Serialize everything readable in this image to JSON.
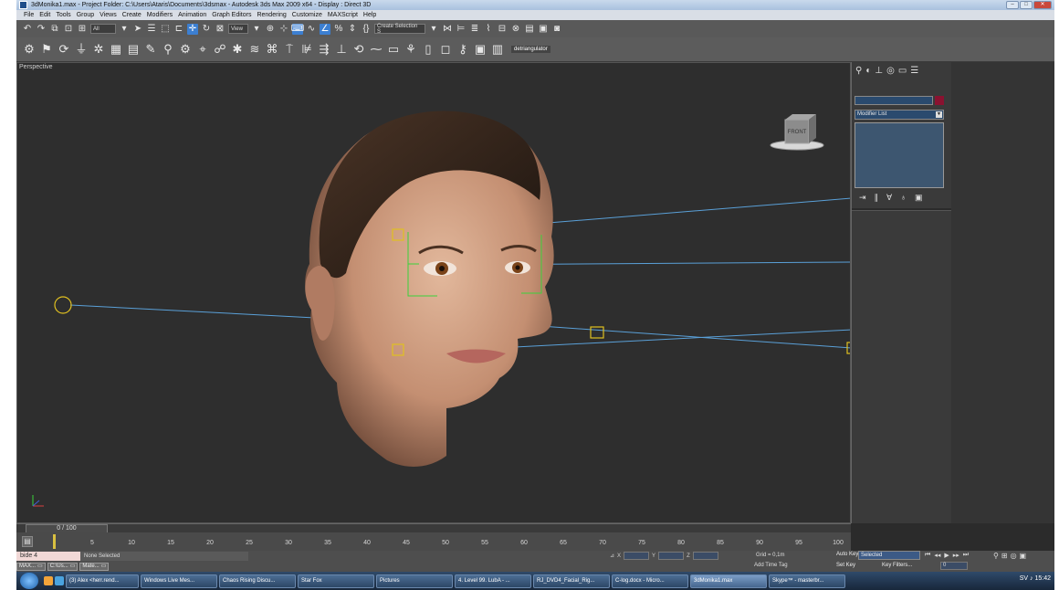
{
  "window": {
    "title": "3dMonika1.max    - Project Folder: C:\\Users\\Ataris\\Documents\\3dsmax    - Autodesk 3ds Max  2009 x64    - Display : Direct 3D",
    "controls": [
      "minimize",
      "maximize",
      "close"
    ]
  },
  "menu": [
    "File",
    "Edit",
    "Tools",
    "Group",
    "Views",
    "Create",
    "Modifiers",
    "Animation",
    "Graph Editors",
    "Rendering",
    "Customize",
    "MAXScript",
    "Help"
  ],
  "toolbar": {
    "selection_filter": "All",
    "ref_coord": "View",
    "named_selection": "Create Selection S",
    "extra_label": "detriangulator"
  },
  "viewport": {
    "label": "Perspective",
    "viewcube_label": "FRONT"
  },
  "command_panel": {
    "modifier_list": "Modifier List",
    "tabs": [
      "create-icon",
      "modify-icon",
      "hierarchy-icon",
      "motion-icon",
      "display-icon",
      "utilities-icon"
    ],
    "stack_tools": [
      "pin-stack-icon",
      "show-end-result-icon",
      "make-unique-icon",
      "remove-modifier-icon",
      "configure-sets-icon"
    ]
  },
  "timeline": {
    "slider_label": "0 / 100",
    "frame_progress": 0.0,
    "ticks": [
      "5",
      "10",
      "15",
      "20",
      "25",
      "30",
      "35",
      "40",
      "45",
      "50",
      "55",
      "60",
      "65",
      "70",
      "75",
      "80",
      "85",
      "90",
      "95",
      "100"
    ]
  },
  "status": {
    "maxscript_listener": "bide 4",
    "selection_status": "None Selected",
    "x_label": "X",
    "y_label": "Y",
    "z_label": "Z",
    "grid": "Grid = 0,1m",
    "add_time_tag": "Add Time Tag",
    "auto_key": "Auto Key",
    "selected": "Selected",
    "set_key": "Set Key",
    "key_filters": "Key Filters...",
    "frame": "0",
    "mini_windows": [
      "MAX...",
      "C:\\Us...",
      "Mate..."
    ]
  },
  "taskbar": {
    "buttons": [
      "(3) Alex <herr.rend...",
      "Windows Live Mes...",
      "Chaos Rising Discu...",
      "Star Fox",
      "Pictures",
      "4. Level 99. LubA - ...",
      "RJ_DVD4_Facial_Rig...",
      "C-log.docx - Micro...",
      "3dMonika1.max",
      "Skype™ - masterbr..."
    ],
    "active_index": 8,
    "clock": "15:42",
    "lang": "SV"
  },
  "colors": {
    "viewport_bg": "#2e2e2e",
    "helper_yellow": "#e0c020",
    "line_blue": "#5aa0d8",
    "selection_green": "#3bd13b"
  }
}
